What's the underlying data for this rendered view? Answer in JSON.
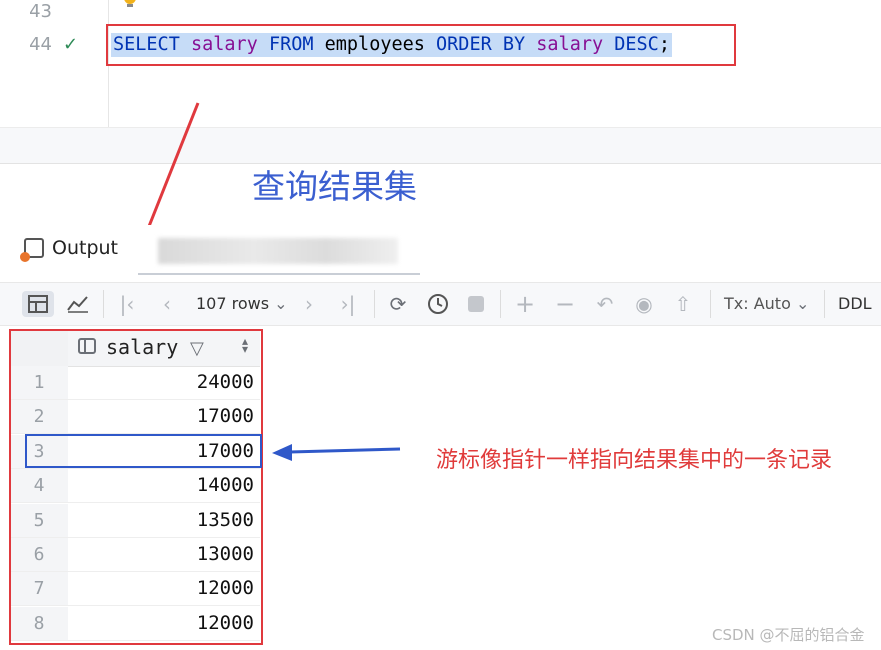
{
  "editor": {
    "line_numbers": [
      "43",
      "44"
    ],
    "sql_tokens": [
      {
        "text": "SELECT",
        "cls": "kw"
      },
      {
        "text": " ",
        "cls": ""
      },
      {
        "text": "salary",
        "cls": "col"
      },
      {
        "text": " ",
        "cls": ""
      },
      {
        "text": "FROM",
        "cls": "kw"
      },
      {
        "text": " employees ",
        "cls": ""
      },
      {
        "text": "ORDER BY",
        "cls": "kw"
      },
      {
        "text": " ",
        "cls": ""
      },
      {
        "text": "salary",
        "cls": "col"
      },
      {
        "text": " ",
        "cls": ""
      },
      {
        "text": "DESC",
        "cls": "kw"
      },
      {
        "text": ";",
        "cls": ""
      }
    ]
  },
  "annotations": {
    "result_set_caption": "查询结果集",
    "cursor_caption": "游标像指针一样指向结果集中的一条记录",
    "colors": {
      "red": "#e0393e",
      "blue": "#2f58c9"
    }
  },
  "tool_window": {
    "output_tab": "Output"
  },
  "toolbar": {
    "rows_label": "107 rows",
    "tx_label": "Tx: Auto",
    "ddl_label": "DDL"
  },
  "grid": {
    "column": "salary",
    "rows": [
      {
        "n": "1",
        "v": "24000"
      },
      {
        "n": "2",
        "v": "17000"
      },
      {
        "n": "3",
        "v": "17000"
      },
      {
        "n": "4",
        "v": "14000"
      },
      {
        "n": "5",
        "v": "13500"
      },
      {
        "n": "6",
        "v": "13000"
      },
      {
        "n": "7",
        "v": "12000"
      },
      {
        "n": "8",
        "v": "12000"
      }
    ]
  },
  "watermark": "CSDN @不屈的铝合金"
}
